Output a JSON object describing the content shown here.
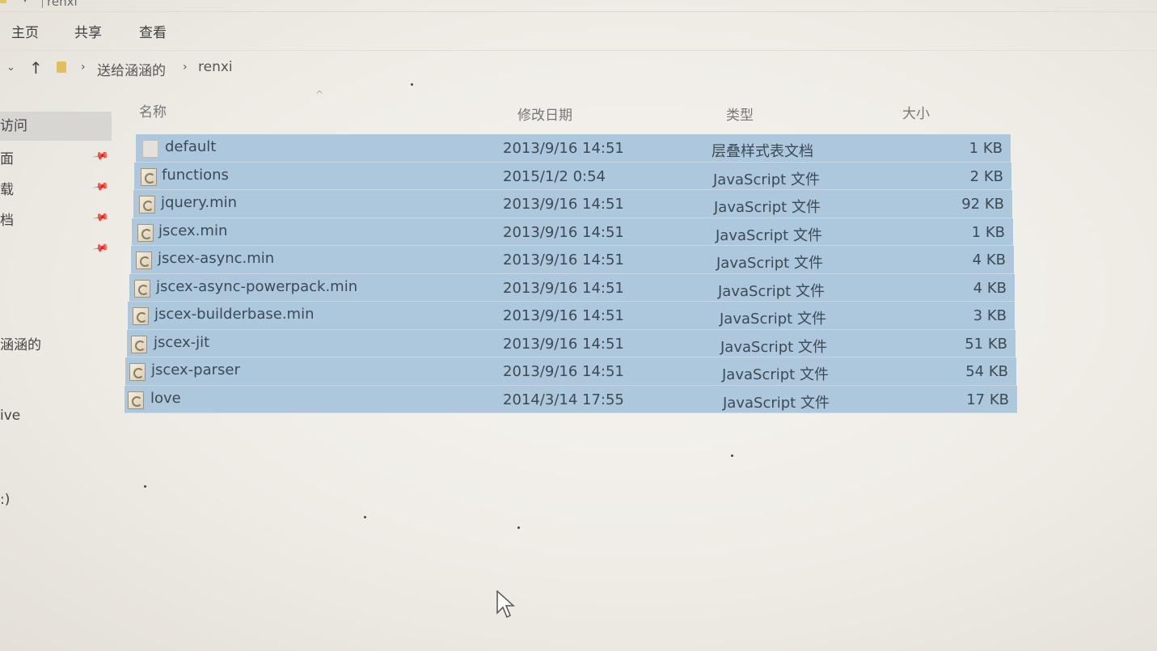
{
  "window": {
    "title": "renxi"
  },
  "ribbon": {
    "tabs": [
      {
        "label": "主页"
      },
      {
        "label": "共享"
      },
      {
        "label": "查看"
      }
    ]
  },
  "address": {
    "crumbs": [
      "送给涵涵的",
      "renxi"
    ]
  },
  "nav": {
    "items": [
      {
        "label": "访问"
      },
      {
        "label": "面"
      },
      {
        "label": "载"
      },
      {
        "label": "档"
      },
      {
        "label": ""
      },
      {
        "label": "涵涵的"
      },
      {
        "label": "ive"
      },
      {
        "label": ":)"
      }
    ]
  },
  "columns": {
    "name": "名称",
    "date": "修改日期",
    "type": "类型",
    "size": "大小"
  },
  "files": [
    {
      "name": "default",
      "date": "2013/9/16 14:51",
      "type": "层叠样式表文档",
      "size": "1 KB",
      "icon": "css-file-icon"
    },
    {
      "name": "functions",
      "date": "2015/1/2 0:54",
      "type": "JavaScript 文件",
      "size": "2 KB",
      "icon": "js-file-icon"
    },
    {
      "name": "jquery.min",
      "date": "2013/9/16 14:51",
      "type": "JavaScript 文件",
      "size": "92 KB",
      "icon": "js-file-icon"
    },
    {
      "name": "jscex.min",
      "date": "2013/9/16 14:51",
      "type": "JavaScript 文件",
      "size": "1 KB",
      "icon": "js-file-icon"
    },
    {
      "name": "jscex-async.min",
      "date": "2013/9/16 14:51",
      "type": "JavaScript 文件",
      "size": "4 KB",
      "icon": "js-file-icon"
    },
    {
      "name": "jscex-async-powerpack.min",
      "date": "2013/9/16 14:51",
      "type": "JavaScript 文件",
      "size": "4 KB",
      "icon": "js-file-icon"
    },
    {
      "name": "jscex-builderbase.min",
      "date": "2013/9/16 14:51",
      "type": "JavaScript 文件",
      "size": "3 KB",
      "icon": "js-file-icon"
    },
    {
      "name": "jscex-jit",
      "date": "2013/9/16 14:51",
      "type": "JavaScript 文件",
      "size": "51 KB",
      "icon": "js-file-icon"
    },
    {
      "name": "jscex-parser",
      "date": "2013/9/16 14:51",
      "type": "JavaScript 文件",
      "size": "54 KB",
      "icon": "js-file-icon"
    },
    {
      "name": "love",
      "date": "2014/3/14 17:55",
      "type": "JavaScript 文件",
      "size": "17 KB",
      "icon": "js-file-icon"
    }
  ],
  "colors": {
    "selection": "#adc8dc",
    "selection_border": "#c7d8e4",
    "background": "#efece6"
  }
}
